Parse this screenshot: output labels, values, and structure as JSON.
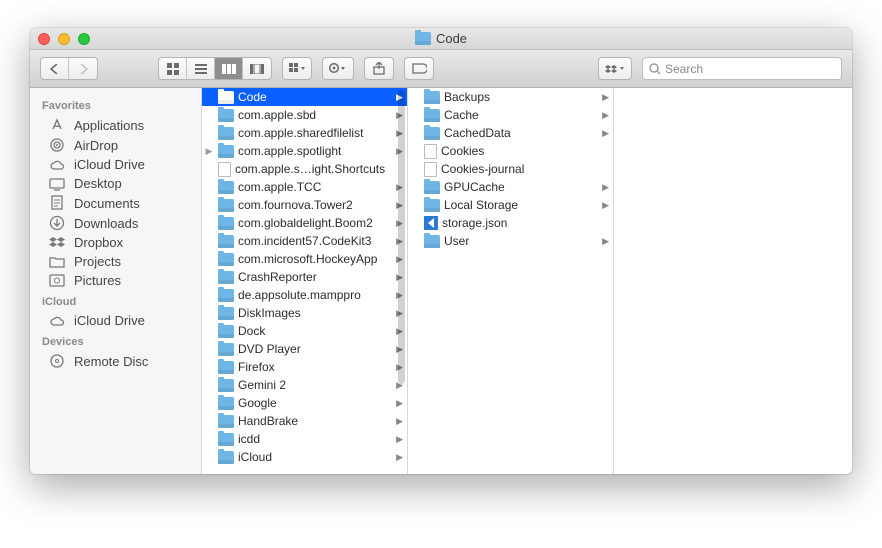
{
  "window": {
    "title": "Code"
  },
  "toolbar": {
    "search_placeholder": "Search"
  },
  "sidebar": {
    "sections": [
      {
        "header": "Favorites",
        "items": [
          {
            "label": "Applications",
            "icon": "app"
          },
          {
            "label": "AirDrop",
            "icon": "airdrop"
          },
          {
            "label": "iCloud Drive",
            "icon": "cloud"
          },
          {
            "label": "Desktop",
            "icon": "desktop"
          },
          {
            "label": "Documents",
            "icon": "doc"
          },
          {
            "label": "Downloads",
            "icon": "down"
          },
          {
            "label": "Dropbox",
            "icon": "dropbox"
          },
          {
            "label": "Projects",
            "icon": "folder"
          },
          {
            "label": "Pictures",
            "icon": "pic"
          }
        ]
      },
      {
        "header": "iCloud",
        "items": [
          {
            "label": "iCloud Drive",
            "icon": "cloud"
          }
        ]
      },
      {
        "header": "Devices",
        "items": [
          {
            "label": "Remote Disc",
            "icon": "disc"
          }
        ]
      }
    ]
  },
  "columns": [
    {
      "items": [
        {
          "name": "Code",
          "type": "folder",
          "children": true,
          "selected": true
        },
        {
          "name": "com.apple.sbd",
          "type": "folder",
          "children": true
        },
        {
          "name": "com.apple.sharedfilelist",
          "type": "folder",
          "children": true
        },
        {
          "name": "com.apple.spotlight",
          "type": "folder",
          "children": true,
          "parentSelected": true
        },
        {
          "name": "com.apple.s…ight.Shortcuts",
          "type": "file"
        },
        {
          "name": "com.apple.TCC",
          "type": "folder",
          "children": true
        },
        {
          "name": "com.fournova.Tower2",
          "type": "folder",
          "children": true
        },
        {
          "name": "com.globaldelight.Boom2",
          "type": "folder",
          "children": true
        },
        {
          "name": "com.incident57.CodeKit3",
          "type": "folder",
          "children": true
        },
        {
          "name": "com.microsoft.HockeyApp",
          "type": "folder",
          "children": true
        },
        {
          "name": "CrashReporter",
          "type": "folder",
          "children": true
        },
        {
          "name": "de.appsolute.mamppro",
          "type": "folder",
          "children": true
        },
        {
          "name": "DiskImages",
          "type": "folder",
          "children": true
        },
        {
          "name": "Dock",
          "type": "folder",
          "children": true
        },
        {
          "name": "DVD Player",
          "type": "folder",
          "children": true
        },
        {
          "name": "Firefox",
          "type": "folder",
          "children": true
        },
        {
          "name": "Gemini 2",
          "type": "folder",
          "children": true
        },
        {
          "name": "Google",
          "type": "folder",
          "children": true
        },
        {
          "name": "HandBrake",
          "type": "folder",
          "children": true
        },
        {
          "name": "icdd",
          "type": "folder",
          "children": true
        },
        {
          "name": "iCloud",
          "type": "folder",
          "children": true
        }
      ]
    },
    {
      "items": [
        {
          "name": "Backups",
          "type": "folder",
          "children": true
        },
        {
          "name": "Cache",
          "type": "folder",
          "children": true
        },
        {
          "name": "CachedData",
          "type": "folder",
          "children": true
        },
        {
          "name": "Cookies",
          "type": "file"
        },
        {
          "name": "Cookies-journal",
          "type": "file"
        },
        {
          "name": "GPUCache",
          "type": "folder",
          "children": true
        },
        {
          "name": "Local Storage",
          "type": "folder",
          "children": true
        },
        {
          "name": "storage.json",
          "type": "vscode"
        },
        {
          "name": "User",
          "type": "folder",
          "children": true
        }
      ]
    }
  ]
}
